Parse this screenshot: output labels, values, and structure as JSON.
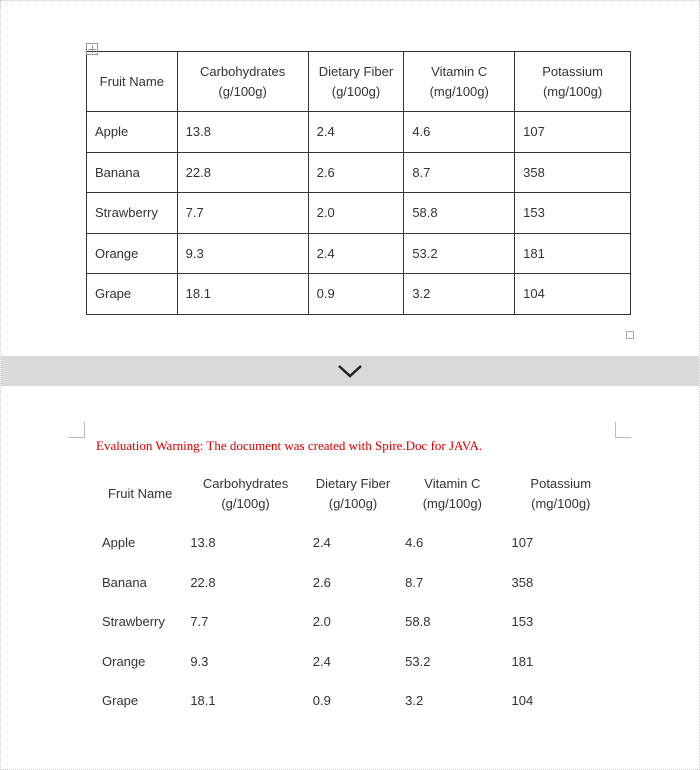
{
  "warning_text": "Evaluation Warning: The document was created with Spire.Doc for JAVA.",
  "headers": [
    "Fruit Name",
    "Carbohydrates (g/100g)",
    "Dietary Fiber (g/100g)",
    "Vitamin C (mg/100g)",
    "Potassium (mg/100g)"
  ],
  "rows": [
    {
      "c0": "Apple",
      "c1": "13.8",
      "c2": "2.4",
      "c3": "4.6",
      "c4": "107"
    },
    {
      "c0": "Banana",
      "c1": "22.8",
      "c2": "2.6",
      "c3": "8.7",
      "c4": "358"
    },
    {
      "c0": "Strawberry",
      "c1": "7.7",
      "c2": "2.0",
      "c3": "58.8",
      "c4": "153"
    },
    {
      "c0": "Orange",
      "c1": "9.3",
      "c2": "2.4",
      "c3": "53.2",
      "c4": "181"
    },
    {
      "c0": "Grape",
      "c1": "18.1",
      "c2": "0.9",
      "c3": "3.2",
      "c4": "104"
    }
  ],
  "chart_data": {
    "type": "table",
    "columns": [
      "Fruit Name",
      "Carbohydrates (g/100g)",
      "Dietary Fiber (g/100g)",
      "Vitamin C (mg/100g)",
      "Potassium (mg/100g)"
    ],
    "data": [
      [
        "Apple",
        13.8,
        2.4,
        4.6,
        107
      ],
      [
        "Banana",
        22.8,
        2.6,
        8.7,
        358
      ],
      [
        "Strawberry",
        7.7,
        2.0,
        58.8,
        153
      ],
      [
        "Orange",
        9.3,
        2.4,
        53.2,
        181
      ],
      [
        "Grape",
        18.1,
        0.9,
        3.2,
        104
      ]
    ]
  }
}
